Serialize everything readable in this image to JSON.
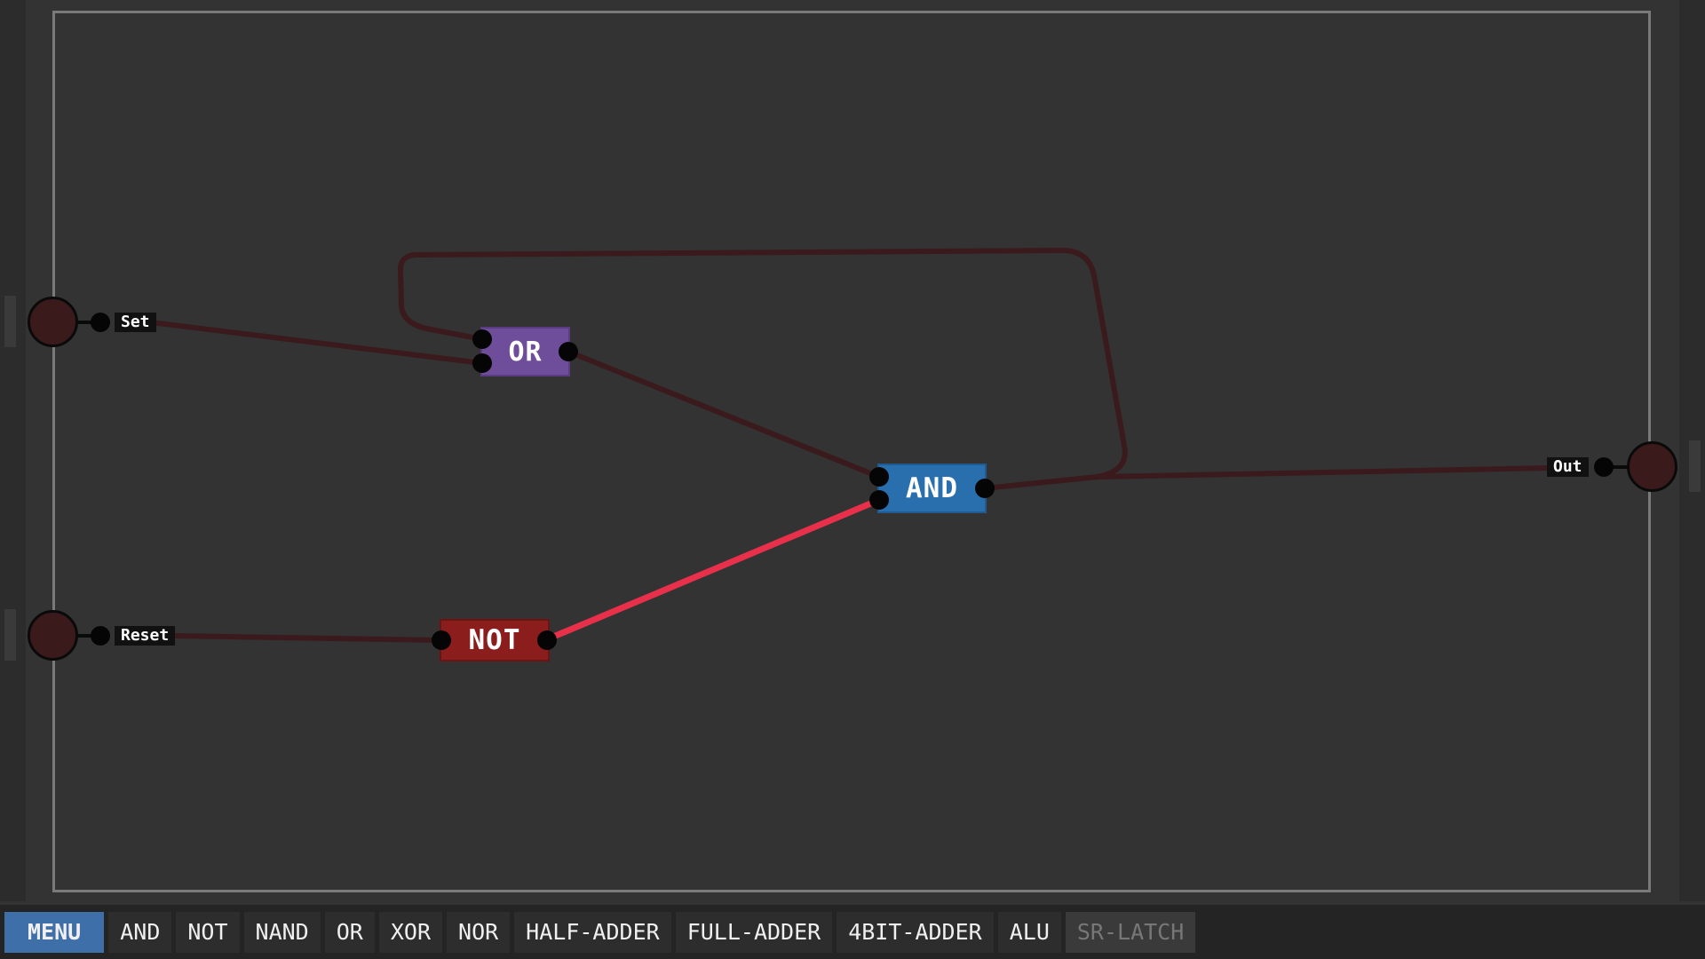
{
  "colors": {
    "background": "#333333",
    "frame": "#7a7a7a",
    "wire_off": "#3a1a1d",
    "wire_on": "#e8304a",
    "gate_or": "#6e4d9a",
    "gate_and": "#2a6fad",
    "gate_not": "#8b1d1d",
    "io_fill": "#3b1a1c",
    "menu_button": "#3e6fa8"
  },
  "inputs": [
    {
      "label": "Set",
      "state": "off"
    },
    {
      "label": "Reset",
      "state": "off"
    }
  ],
  "outputs": [
    {
      "label": "Out",
      "state": "off"
    }
  ],
  "gates": [
    {
      "id": "or",
      "label": "OR"
    },
    {
      "id": "and",
      "label": "AND"
    },
    {
      "id": "not",
      "label": "NOT"
    }
  ],
  "wires": [
    {
      "from": "Set",
      "to": "OR.in2",
      "state": "off"
    },
    {
      "from": "AND.out",
      "to": "OR.in1",
      "state": "off"
    },
    {
      "from": "OR.out",
      "to": "AND.in1",
      "state": "off"
    },
    {
      "from": "Reset",
      "to": "NOT.in",
      "state": "off"
    },
    {
      "from": "NOT.out",
      "to": "AND.in2",
      "state": "on"
    },
    {
      "from": "AND.out",
      "to": "Out",
      "state": "off"
    }
  ],
  "toolbar": {
    "menu_label": "MENU",
    "items": [
      "AND",
      "NOT",
      "NAND",
      "OR",
      "XOR",
      "NOR",
      "HALF-ADDER",
      "FULL-ADDER",
      "4BIT-ADDER",
      "ALU"
    ],
    "current_label": "SR-LATCH"
  }
}
